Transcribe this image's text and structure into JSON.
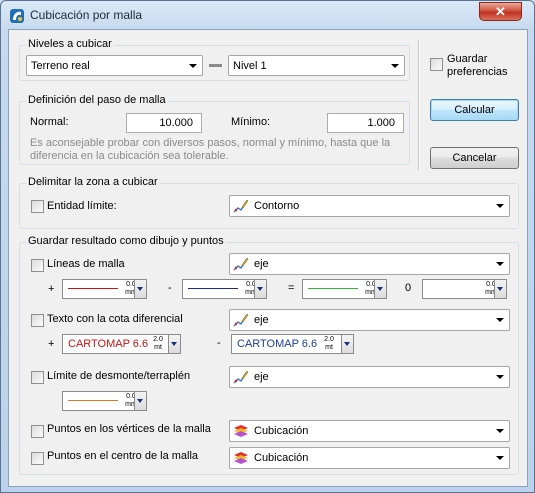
{
  "window": {
    "title": "Cubicación por malla",
    "close_glyph": "✕"
  },
  "niveles": {
    "title": "Niveles a cubicar",
    "from": "Terreno real",
    "to": "Nivel 1"
  },
  "guardar_pref": {
    "label_line1": "Guardar",
    "label_line2": "preferencias"
  },
  "buttons": {
    "calcular": "Calcular",
    "cancelar": "Cancelar"
  },
  "paso": {
    "title": "Definición del paso de malla",
    "normal_label": "Normal:",
    "normal_value": "10.000",
    "minimo_label": "Mínimo:",
    "minimo_value": "1.000",
    "hint_line1": "Es aconsejable probar con diversos pasos, normal y mínimo, hasta que la",
    "hint_line2": "diferencia en la cubicación sea tolerable."
  },
  "zona": {
    "title": "Delimitar la zona a cubicar",
    "entidad_label": "Entidad límite:",
    "entidad_value": "Contorno"
  },
  "guardar": {
    "title": "Guardar resultado como dibujo y puntos",
    "lineas_label": "Líneas de malla",
    "lineas_layer": "eje",
    "plus": "+",
    "minus": "-",
    "equals": "=",
    "zero": "0",
    "line_width_top": "0.0",
    "line_width_unit": "mm",
    "line_colors": {
      "plus": "#d01010",
      "minus": "#1a2a8a",
      "equals": "#30b830",
      "zero": "#ffffff",
      "limite": "#e07a20"
    },
    "texto_label": "Texto con la cota diferencial",
    "texto_layer": "eje",
    "text_style": "CARTOMAP 6.6",
    "text_size_top": "2.0",
    "text_size_unit": "mt",
    "text_colors": {
      "plus": "#d01010",
      "minus": "#1a3aa8"
    },
    "limite_label": "Límite de desmonte/terraplén",
    "limite_layer": "eje",
    "vertices_label": "Puntos en los vértices de la malla",
    "vertices_layer": "Cubicación",
    "centro_label": "Puntos en el centro de la malla",
    "centro_layer": "Cubicación"
  }
}
